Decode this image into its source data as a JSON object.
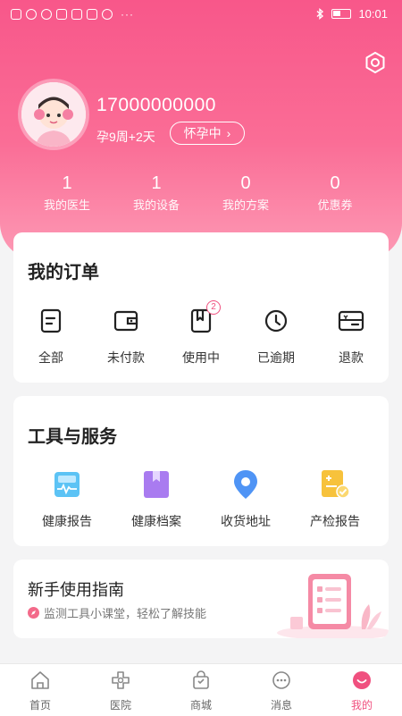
{
  "status_bar": {
    "time": "10:01",
    "more_indicator": "···"
  },
  "header": {
    "settings_icon": "hexagon-settings-icon",
    "phone": "17000000000",
    "pregnancy_week": "孕9周+2天",
    "pregnancy_status": "怀孕中",
    "pregnancy_status_chevron": "›",
    "stats": [
      {
        "value": "1",
        "label": "我的医生"
      },
      {
        "value": "1",
        "label": "我的设备"
      },
      {
        "value": "0",
        "label": "我的方案"
      },
      {
        "value": "0",
        "label": "优惠券"
      }
    ]
  },
  "orders": {
    "title": "我的订单",
    "items": [
      {
        "label": "全部",
        "icon": "document-icon"
      },
      {
        "label": "未付款",
        "icon": "wallet-icon"
      },
      {
        "label": "使用中",
        "icon": "bookmark-icon",
        "badge": "2"
      },
      {
        "label": "已逾期",
        "icon": "clock-icon"
      },
      {
        "label": "退款",
        "icon": "refund-card-icon"
      }
    ]
  },
  "tools": {
    "title": "工具与服务",
    "items": [
      {
        "label": "健康报告",
        "icon": "health-report-icon"
      },
      {
        "label": "健康档案",
        "icon": "health-file-icon"
      },
      {
        "label": "收货地址",
        "icon": "location-pin-icon"
      },
      {
        "label": "产检报告",
        "icon": "checkup-report-icon"
      }
    ]
  },
  "guide": {
    "title": "新手使用指南",
    "subtitle": "监测工具小课堂，轻松了解技能"
  },
  "tabbar": {
    "items": [
      {
        "label": "首页",
        "icon": "home-icon"
      },
      {
        "label": "医院",
        "icon": "hospital-icon"
      },
      {
        "label": "商城",
        "icon": "shop-bag-icon"
      },
      {
        "label": "消息",
        "icon": "message-icon"
      },
      {
        "label": "我的",
        "icon": "profile-icon",
        "active": true
      }
    ]
  },
  "colors": {
    "brand_pink": "#f8578a",
    "accent": "#f0507f"
  }
}
